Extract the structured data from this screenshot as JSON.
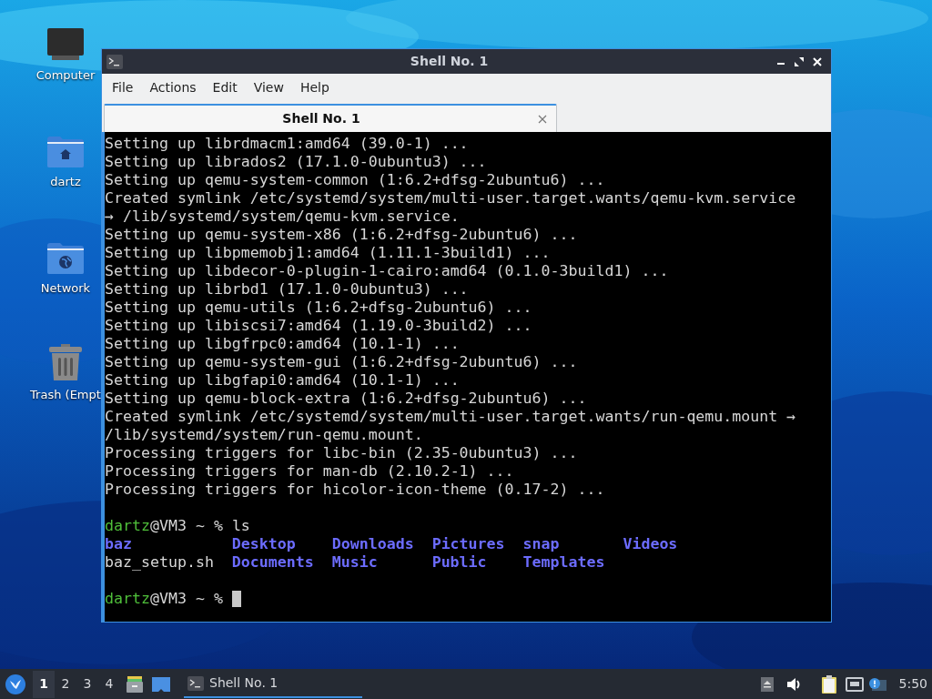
{
  "desktop_icons": [
    {
      "label": "Computer",
      "kind": "computer"
    },
    {
      "label": "dartz",
      "kind": "home"
    },
    {
      "label": "Network",
      "kind": "network"
    },
    {
      "label": "Trash (Empt",
      "kind": "trash"
    }
  ],
  "window": {
    "title": "Shell No. 1",
    "menu": [
      "File",
      "Actions",
      "Edit",
      "View",
      "Help"
    ],
    "tabs": [
      {
        "label": "Shell No. 1",
        "selected": true
      }
    ],
    "terminal": {
      "lines": [
        {
          "kind": "text",
          "text": "Setting up librdmacm1:amd64 (39.0-1) ..."
        },
        {
          "kind": "text",
          "text": "Setting up librados2 (17.1.0-0ubuntu3) ..."
        },
        {
          "kind": "text",
          "text": "Setting up qemu-system-common (1:6.2+dfsg-2ubuntu6) ..."
        },
        {
          "kind": "text",
          "text": "Created symlink /etc/systemd/system/multi-user.target.wants/qemu-kvm.service"
        },
        {
          "kind": "text",
          "text": "→ /lib/systemd/system/qemu-kvm.service."
        },
        {
          "kind": "text",
          "text": "Setting up qemu-system-x86 (1:6.2+dfsg-2ubuntu6) ..."
        },
        {
          "kind": "text",
          "text": "Setting up libpmemobj1:amd64 (1.11.1-3build1) ..."
        },
        {
          "kind": "text",
          "text": "Setting up libdecor-0-plugin-1-cairo:amd64 (0.1.0-3build1) ..."
        },
        {
          "kind": "text",
          "text": "Setting up librbd1 (17.1.0-0ubuntu3) ..."
        },
        {
          "kind": "text",
          "text": "Setting up qemu-utils (1:6.2+dfsg-2ubuntu6) ..."
        },
        {
          "kind": "text",
          "text": "Setting up libiscsi7:amd64 (1.19.0-3build2) ..."
        },
        {
          "kind": "text",
          "text": "Setting up libgfrpc0:amd64 (10.1-1) ..."
        },
        {
          "kind": "text",
          "text": "Setting up qemu-system-gui (1:6.2+dfsg-2ubuntu6) ..."
        },
        {
          "kind": "text",
          "text": "Setting up libgfapi0:amd64 (10.1-1) ..."
        },
        {
          "kind": "text",
          "text": "Setting up qemu-block-extra (1:6.2+dfsg-2ubuntu6) ..."
        },
        {
          "kind": "text",
          "text": "Created symlink /etc/systemd/system/multi-user.target.wants/run-qemu.mount →"
        },
        {
          "kind": "text",
          "text": "/lib/systemd/system/run-qemu.mount."
        },
        {
          "kind": "text",
          "text": "Processing triggers for libc-bin (2.35-0ubuntu3) ..."
        },
        {
          "kind": "text",
          "text": "Processing triggers for man-db (2.10.2-1) ..."
        },
        {
          "kind": "text",
          "text": "Processing triggers for hicolor-icon-theme (0.17-2) ..."
        },
        {
          "kind": "blank"
        },
        {
          "kind": "prompt",
          "user": "dartz",
          "rest": "@VM3 ~ %",
          "command": "ls"
        },
        {
          "kind": "listing",
          "entries": [
            {
              "name": "baz",
              "kind": "dir"
            },
            {
              "name": "baz_setup.sh",
              "kind": "file"
            },
            {
              "name": "Desktop",
              "kind": "dir"
            },
            {
              "name": "Documents",
              "kind": "dir"
            },
            {
              "name": "Downloads",
              "kind": "dir"
            },
            {
              "name": "Music",
              "kind": "dir"
            },
            {
              "name": "Pictures",
              "kind": "dir"
            },
            {
              "name": "Public",
              "kind": "dir"
            },
            {
              "name": "snap",
              "kind": "dir"
            },
            {
              "name": "Templates",
              "kind": "dir"
            },
            {
              "name": "Videos",
              "kind": "dir"
            }
          ]
        },
        {
          "kind": "blank"
        },
        {
          "kind": "prompt",
          "user": "dartz",
          "rest": "@VM3 ~ %",
          "cursor": true
        }
      ]
    }
  },
  "taskbar": {
    "workspaces": [
      {
        "label": "1",
        "selected": true
      },
      {
        "label": "2",
        "selected": false
      },
      {
        "label": "3",
        "selected": false
      },
      {
        "label": "4",
        "selected": false
      }
    ],
    "tasks": [
      {
        "label": "Shell No. 1",
        "selected": true
      }
    ],
    "clock": "5:50"
  }
}
